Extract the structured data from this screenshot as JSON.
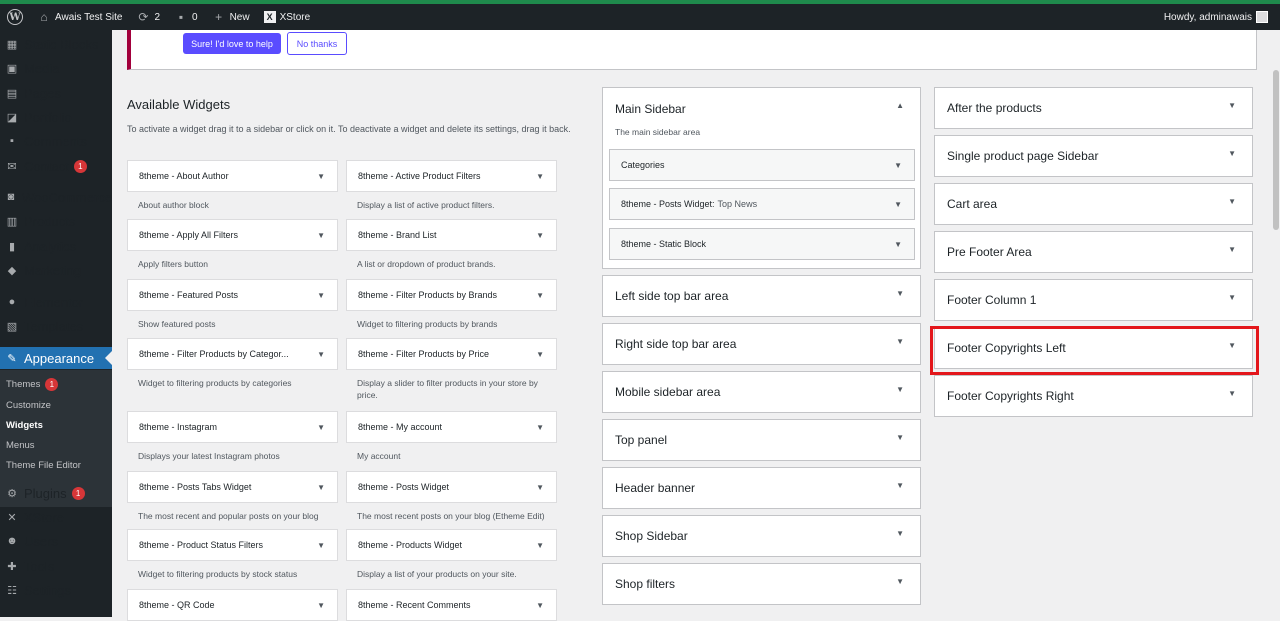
{
  "adminbar": {
    "site_name": "Awais Test Site",
    "updates_count": "2",
    "comments_count": "0",
    "new_label": "New",
    "xstore_label": "XStore",
    "howdy": "Howdy, adminawais"
  },
  "sidebar": {
    "items": [
      {
        "label": "Static Blocks",
        "icon": "static-blocks-icon"
      },
      {
        "label": "Media",
        "icon": "media-icon"
      },
      {
        "label": "Pages",
        "icon": "pages-icon"
      },
      {
        "label": "Portfolio",
        "icon": "portfolio-icon"
      },
      {
        "label": "Comments",
        "icon": "comments-icon"
      },
      {
        "label": "Contact",
        "icon": "contact-icon",
        "badge": "1"
      },
      {
        "label": "WooCommerce",
        "icon": "woocommerce-icon"
      },
      {
        "label": "Products",
        "icon": "products-icon"
      },
      {
        "label": "Analytics",
        "icon": "analytics-icon"
      },
      {
        "label": "Marketing",
        "icon": "marketing-icon"
      },
      {
        "label": "Elementor",
        "icon": "elementor-icon"
      },
      {
        "label": "Templates",
        "icon": "templates-icon"
      },
      {
        "label": "Appearance",
        "icon": "appearance-icon"
      },
      {
        "label": "Plugins",
        "icon": "plugins-icon",
        "badge": "1"
      },
      {
        "label": "XStore",
        "icon": "xstore-icon"
      },
      {
        "label": "Users",
        "icon": "users-icon"
      },
      {
        "label": "Tools",
        "icon": "tools-icon"
      },
      {
        "label": "Settings",
        "icon": "settings-icon"
      }
    ],
    "submenu": [
      {
        "label": "Themes",
        "badge": "1"
      },
      {
        "label": "Customize"
      },
      {
        "label": "Widgets"
      },
      {
        "label": "Menus"
      },
      {
        "label": "Theme File Editor"
      }
    ]
  },
  "notice": {
    "primary_button": "Sure! I'd love to help",
    "secondary_button": "No thanks"
  },
  "available_widgets": {
    "title": "Available Widgets",
    "description": "To activate a widget drag it to a sidebar or click on it. To deactivate a widget and delete its settings, drag it back.",
    "widgets": [
      {
        "name": "8theme - About Author",
        "desc": "About author block"
      },
      {
        "name": "8theme - Active Product Filters",
        "desc": "Display a list of active product filters."
      },
      {
        "name": "8theme - Apply All Filters",
        "desc": "Apply filters button"
      },
      {
        "name": "8theme - Brand List",
        "desc": "A list or dropdown of product brands."
      },
      {
        "name": "8theme - Featured Posts",
        "desc": "Show featured posts"
      },
      {
        "name": "8theme - Filter Products by Brands",
        "desc": "Widget to filtering products by brands"
      },
      {
        "name": "8theme - Filter Products by Categor...",
        "desc": "Widget to filtering products by categories"
      },
      {
        "name": "8theme - Filter Products by Price",
        "desc": "Display a slider to filter products in your store by price."
      },
      {
        "name": "8theme - Instagram",
        "desc": "Displays your latest Instagram photos"
      },
      {
        "name": "8theme - My account",
        "desc": "My account"
      },
      {
        "name": "8theme - Posts Tabs Widget",
        "desc": "The most recent and popular posts on your blog"
      },
      {
        "name": "8theme - Posts Widget",
        "desc": "The most recent posts on your blog (Etheme Edit)"
      },
      {
        "name": "8theme - Product Status Filters",
        "desc": "Widget to filtering products by stock status"
      },
      {
        "name": "8theme - Products Widget",
        "desc": "Display a list of your products on your site."
      },
      {
        "name": "8theme - QR Code",
        "desc": ""
      },
      {
        "name": "8theme - Recent Comments",
        "desc": ""
      }
    ]
  },
  "main_sidebar": {
    "title": "Main Sidebar",
    "description": "The main sidebar area",
    "widgets": [
      {
        "name": "Categories",
        "sub": ""
      },
      {
        "name": "8theme - Posts Widget:",
        "sub": "Top News"
      },
      {
        "name": "8theme - Static Block",
        "sub": ""
      }
    ]
  },
  "middle_areas": [
    "Left side top bar area",
    "Right side top bar area",
    "Mobile sidebar area",
    "Top panel",
    "Header banner",
    "Shop Sidebar",
    "Shop filters"
  ],
  "right_areas": [
    "After the products",
    "Single product page Sidebar",
    "Cart area",
    "Pre Footer Area",
    "Footer Column 1",
    "Footer Copyrights Left",
    "Footer Copyrights Right"
  ],
  "colors": {
    "highlight": "#e3161b",
    "accent": "#2271b1",
    "notice_button": "#5a4cff"
  }
}
